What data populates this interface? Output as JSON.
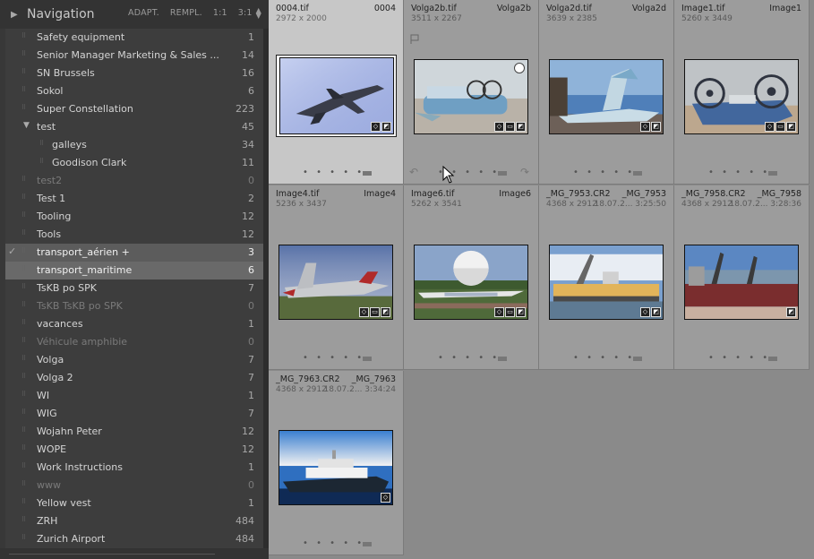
{
  "navigator": {
    "title": "Navigation",
    "options": [
      "ADAPT.",
      "REMPL.",
      "1:1",
      "3:1"
    ]
  },
  "collections": [
    {
      "label": "Safety equipment",
      "count": "1",
      "state": "normal"
    },
    {
      "label": "Senior Manager Marketing & Sales ...",
      "count": "14",
      "state": "normal"
    },
    {
      "label": "SN Brussels",
      "count": "16",
      "state": "normal"
    },
    {
      "label": "Sokol",
      "count": "6",
      "state": "normal"
    },
    {
      "label": "Super Constellation",
      "count": "223",
      "state": "normal"
    },
    {
      "label": "test",
      "count": "45",
      "state": "expanded"
    },
    {
      "label": "galleys",
      "count": "34",
      "state": "child"
    },
    {
      "label": "Goodison Clark",
      "count": "11",
      "state": "child"
    },
    {
      "label": "test2",
      "count": "0",
      "state": "dim"
    },
    {
      "label": "Test 1",
      "count": "2",
      "state": "normal"
    },
    {
      "label": "Tooling",
      "count": "12",
      "state": "normal"
    },
    {
      "label": "Tools",
      "count": "12",
      "state": "normal"
    },
    {
      "label": "transport_aérien +",
      "count": "3",
      "state": "selected-target"
    },
    {
      "label": "transport_maritime",
      "count": "6",
      "state": "selected"
    },
    {
      "label": "TsKB po SPK",
      "count": "7",
      "state": "normal"
    },
    {
      "label": "TsKB TsKB po SPK",
      "count": "0",
      "state": "dim"
    },
    {
      "label": "vacances",
      "count": "1",
      "state": "normal"
    },
    {
      "label": "Véhicule amphibie",
      "count": "0",
      "state": "dim"
    },
    {
      "label": "Volga",
      "count": "7",
      "state": "normal"
    },
    {
      "label": "Volga 2",
      "count": "7",
      "state": "normal"
    },
    {
      "label": "WI",
      "count": "1",
      "state": "normal"
    },
    {
      "label": "WIG",
      "count": "7",
      "state": "normal"
    },
    {
      "label": "Wojahn Peter",
      "count": "12",
      "state": "normal"
    },
    {
      "label": "WOPE",
      "count": "12",
      "state": "normal"
    },
    {
      "label": "Work Instructions",
      "count": "1",
      "state": "normal"
    },
    {
      "label": "www",
      "count": "0",
      "state": "dim"
    },
    {
      "label": "Yellow vest",
      "count": "1",
      "state": "normal"
    },
    {
      "label": "ZRH",
      "count": "484",
      "state": "normal"
    },
    {
      "label": "Zurich Airport",
      "count": "484",
      "state": "normal"
    }
  ],
  "thumbnails": [
    {
      "file": "0004.tif",
      "num": "0004",
      "dims": "2972 x 2000",
      "date": "",
      "selected": true,
      "subject": "jet-fighter"
    },
    {
      "file": "Volga2b.tif",
      "num": "Volga2b",
      "dims": "3511 x 2267",
      "date": "",
      "selected": false,
      "subject": "hovercraft-beach"
    },
    {
      "file": "Volga2d.tif",
      "num": "Volga2d",
      "dims": "3639 x 2385",
      "date": "",
      "selected": false,
      "subject": "ekranoplan"
    },
    {
      "file": "Image1.tif",
      "num": "Image1",
      "dims": "5260 x 3449",
      "date": "",
      "selected": false,
      "subject": "hovercraft-fans"
    },
    {
      "file": "Image4.tif",
      "num": "Image4",
      "dims": "5236 x 3437",
      "date": "",
      "selected": false,
      "subject": "jet-grass"
    },
    {
      "file": "Image6.tif",
      "num": "Image6",
      "dims": "5262 x 3541",
      "date": "",
      "selected": false,
      "subject": "balloon-plane"
    },
    {
      "file": "_MG_7953.CR2",
      "num": "_MG_7953",
      "dims": "4368 x 2912",
      "date": "18.07.2... 3:25:50",
      "selected": false,
      "subject": "ship-yellow"
    },
    {
      "file": "_MG_7958.CR2",
      "num": "_MG_7958",
      "dims": "4368 x 2912",
      "date": "18.07.2... 3:28:36",
      "selected": false,
      "subject": "ship-red"
    },
    {
      "file": "_MG_7963.CR2",
      "num": "_MG_7963",
      "dims": "4368 x 2912",
      "date": "18.07.2... 3:34:24",
      "selected": false,
      "subject": "yacht"
    }
  ],
  "rating_dots": "• • • • •"
}
